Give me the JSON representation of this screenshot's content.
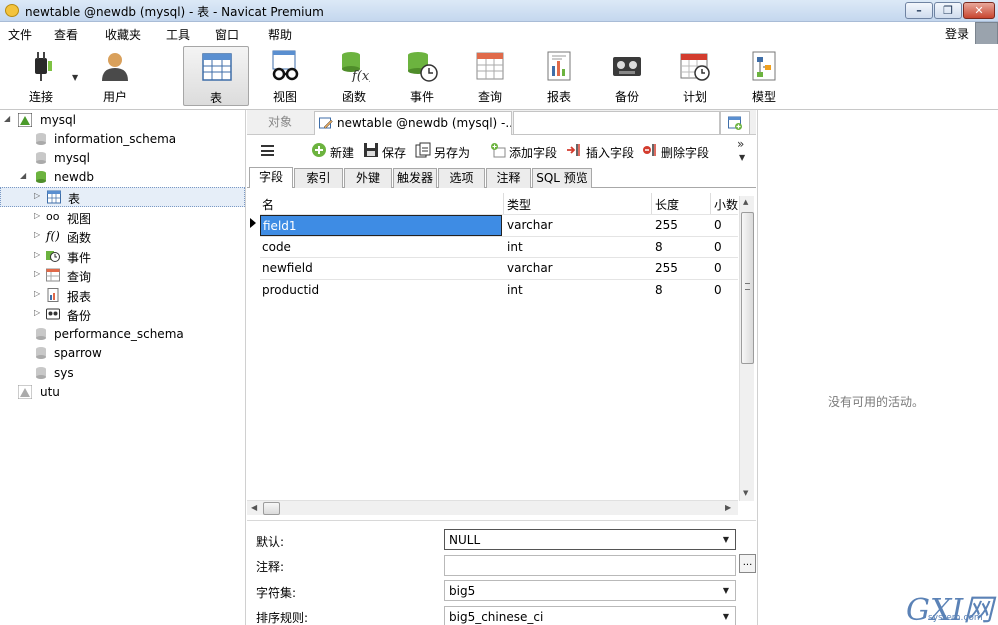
{
  "window": {
    "title": "newtable @newdb (mysql) - 表 - Navicat Premium"
  },
  "menubar": {
    "items": [
      "文件",
      "查看",
      "收藏夹",
      "工具",
      "窗口",
      "帮助"
    ],
    "login": "登录"
  },
  "toolbar": {
    "items": [
      {
        "label": "连接",
        "icon": "plug-icon"
      },
      {
        "label": "用户",
        "icon": "user-icon"
      },
      {
        "label": "表",
        "icon": "table-icon"
      },
      {
        "label": "视图",
        "icon": "view-glasses-icon"
      },
      {
        "label": "函数",
        "icon": "function-icon"
      },
      {
        "label": "事件",
        "icon": "event-clock-icon"
      },
      {
        "label": "查询",
        "icon": "query-icon"
      },
      {
        "label": "报表",
        "icon": "report-icon"
      },
      {
        "label": "备份",
        "icon": "backup-tape-icon"
      },
      {
        "label": "计划",
        "icon": "calendar-schedule-icon"
      },
      {
        "label": "模型",
        "icon": "model-icon"
      }
    ],
    "active": "表"
  },
  "sidebar": {
    "connection": "mysql",
    "databases": [
      "information_schema",
      "mysql"
    ],
    "open_db": "newdb",
    "objects": [
      "表",
      "视图",
      "函数",
      "事件",
      "查询",
      "报表",
      "备份"
    ],
    "databases_after": [
      "performance_schema",
      "sparrow",
      "sys"
    ],
    "other_connection": "utu"
  },
  "tabs": {
    "objects": "对象",
    "current": "newtable @newdb (mysql) -..."
  },
  "subtoolbar": {
    "new": "新建",
    "save": "保存",
    "save_as": "另存为",
    "add_field": "添加字段",
    "insert_field": "插入字段",
    "delete_field": "删除字段",
    "more": "»"
  },
  "inner_tabs": [
    "字段",
    "索引",
    "外键",
    "触发器",
    "选项",
    "注释",
    "SQL 预览"
  ],
  "grid": {
    "columns": [
      "名",
      "类型",
      "长度",
      "小数"
    ],
    "rows": [
      {
        "name": "field1",
        "type": "varchar",
        "length": "255",
        "decimals": "0"
      },
      {
        "name": "code",
        "type": "int",
        "length": "8",
        "decimals": "0"
      },
      {
        "name": "newfield",
        "type": "varchar",
        "length": "255",
        "decimals": "0"
      },
      {
        "name": "productid",
        "type": "int",
        "length": "8",
        "decimals": "0"
      }
    ]
  },
  "properties": {
    "default_label": "默认:",
    "default_value": "NULL",
    "comment_label": "注释:",
    "comment_value": "",
    "charset_label": "字符集:",
    "charset_value": "big5",
    "collation_label": "排序规则:",
    "collation_value": "big5_chinese_ci"
  },
  "right_pane": {
    "message": "没有可用的活动。"
  },
  "watermark": {
    "brand": "GXI网",
    "site": "system.com"
  },
  "colors": {
    "selection": "#3e8ce4",
    "accent": "#5b82b6"
  }
}
